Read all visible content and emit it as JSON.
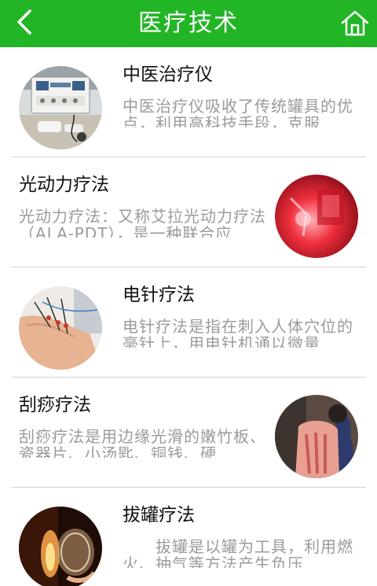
{
  "header": {
    "title": "医疗技术",
    "back_icon": "back-arrow-icon",
    "home_icon": "home-icon",
    "bg_color": "#22b526"
  },
  "items": [
    {
      "title": "中医治疗仪",
      "desc": "中医治疗仪吸收了传统罐具的优点，利用高科技手段，克服",
      "image": "treatment-device-photo"
    },
    {
      "title": "光动力疗法",
      "desc": "光动力疗法：又称艾拉光动力疗法（ALA-PDT），是一种联合应",
      "image": "red-light-therapy-photo"
    },
    {
      "title": "电针疗法",
      "desc": "电针疗法是指在刺入人体穴位的毫针上，用电针机通以微量",
      "image": "electro-acupuncture-photo"
    },
    {
      "title": "刮痧疗法",
      "desc": "刮痧疗法是用边缘光滑的嫩竹板、瓷器片、小汤匙、铜钱、硬",
      "image": "gua-sha-photo"
    },
    {
      "title": "拔罐疗法",
      "desc": "　　拔罐是以罐为工具，利用燃火、抽气等方法产生负压",
      "image": "cupping-photo"
    }
  ]
}
